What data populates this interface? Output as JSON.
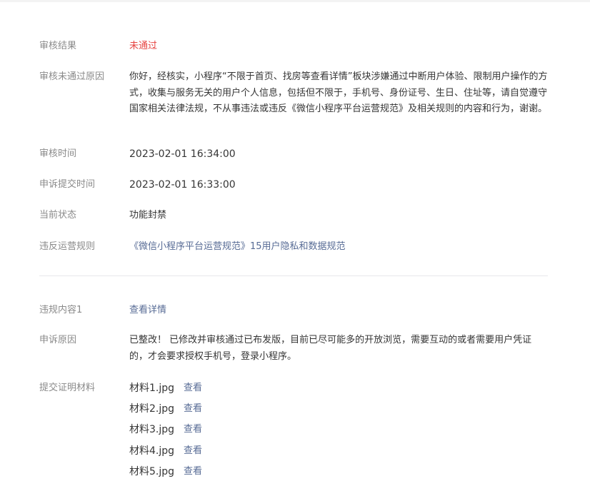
{
  "review": {
    "result_label": "审核结果",
    "result_value": "未通过",
    "reason_label": "审核未通过原因",
    "reason_value": "你好，经核实，小程序“不限于首页、找房等查看详情”板块涉嫌通过中断用户体验、限制用户操作的方式，收集与服务无关的用户个人信息，包括但不限于，手机号、身份证号、生日、住址等，请自觉遵守国家相关法律法规，不从事违法或违反《微信小程序平台运营规范》及相关规则的内容和行为，谢谢。",
    "review_time_label": "审核时间",
    "review_time_value": "2023-02-01 16:34:00",
    "appeal_time_label": "申诉提交时间",
    "appeal_time_value": "2023-02-01 16:33:00",
    "status_label": "当前状态",
    "status_value": "功能封禁",
    "rule_label": "违反运营规则",
    "rule_value": "《微信小程序平台运营规范》15用户隐私和数据规范"
  },
  "appeal": {
    "violation_label": "违规内容1",
    "violation_link": "查看详情",
    "reason_label": "申诉原因",
    "reason_value": "已整改！ 已修改并审核通过已布发版，目前已尽可能多的开放浏览，需要互动的或者需要用户凭证的，才会要求授权手机号，登录小程序。",
    "evidence_label": "提交证明材料",
    "files": [
      {
        "name": "材料1.jpg",
        "action": "查看"
      },
      {
        "name": "材料2.jpg",
        "action": "查看"
      },
      {
        "name": "材料3.jpg",
        "action": "查看"
      },
      {
        "name": "材料4.jpg",
        "action": "查看"
      },
      {
        "name": "材料5.jpg",
        "action": "查看"
      }
    ]
  },
  "colors": {
    "fail_red": "#e64340",
    "link_blue": "#576b95",
    "label_gray": "#8a8a8a",
    "text_dark": "#353535"
  }
}
